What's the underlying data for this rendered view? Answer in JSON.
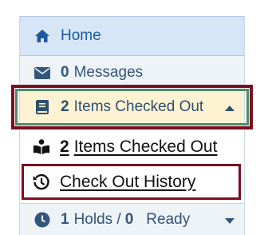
{
  "menu": {
    "home_label": "Home",
    "messages_count": "0",
    "messages_label": "Messages",
    "checked_out_count": "2",
    "checked_out_label": "Items Checked Out",
    "sub_items_count": "2",
    "sub_items_label": "Items Checked Out",
    "history_label": "Check Out History",
    "holds_count": "1",
    "holds_label": "Holds /",
    "ready_count": "0",
    "ready_label": "Ready"
  },
  "colors": {
    "home_bg": "#d6e6f7",
    "active_bg": "#fdf3d3",
    "highlight_border": "#7a1020",
    "inner_border": "#4f8a6b"
  },
  "icons": {
    "home": "home-icon",
    "messages": "envelope-icon",
    "checked_out": "book-icon",
    "readers": "reader-icon",
    "history": "history-icon",
    "holds": "clock-icon",
    "caret_up": "caret-up-icon",
    "caret_down": "caret-down-icon"
  }
}
